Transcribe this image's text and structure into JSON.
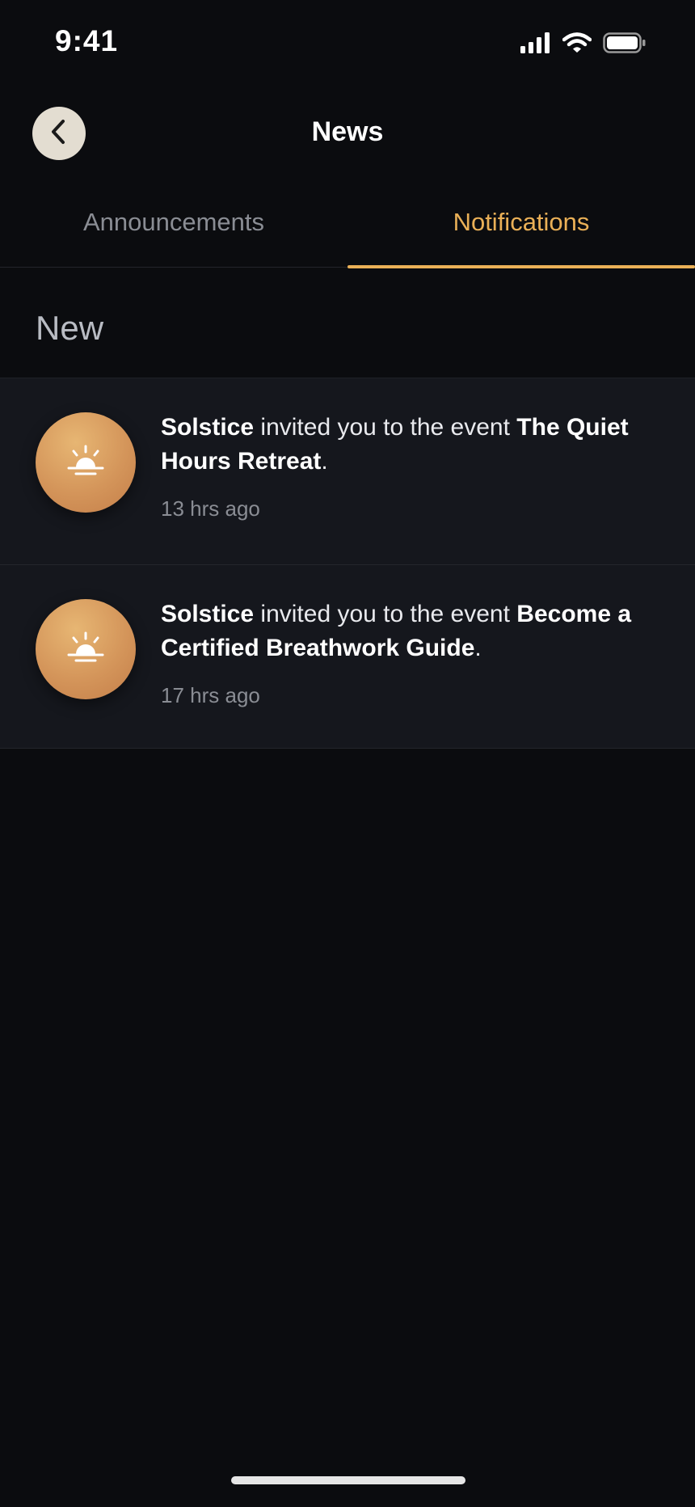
{
  "status_bar": {
    "time": "9:41"
  },
  "header": {
    "title": "News"
  },
  "tabs": [
    {
      "label": "Announcements",
      "active": false
    },
    {
      "label": "Notifications",
      "active": true
    }
  ],
  "section": {
    "title": "New"
  },
  "notifications": [
    {
      "sender": "Solstice",
      "action": "invited you to the event",
      "event": "The Quiet Hours Retreat",
      "suffix": ".",
      "time": "13 hrs ago",
      "icon": "sunrise-icon"
    },
    {
      "sender": "Solstice",
      "action": "invited you to the event",
      "event": "Become a Certified Breathwork Guide",
      "suffix": ".",
      "time": "17 hrs ago",
      "icon": "sunrise-icon"
    }
  ],
  "colors": {
    "background": "#0b0c0f",
    "accent": "#eab057",
    "row_background": "#15171d",
    "muted_text": "#8a8d94"
  }
}
